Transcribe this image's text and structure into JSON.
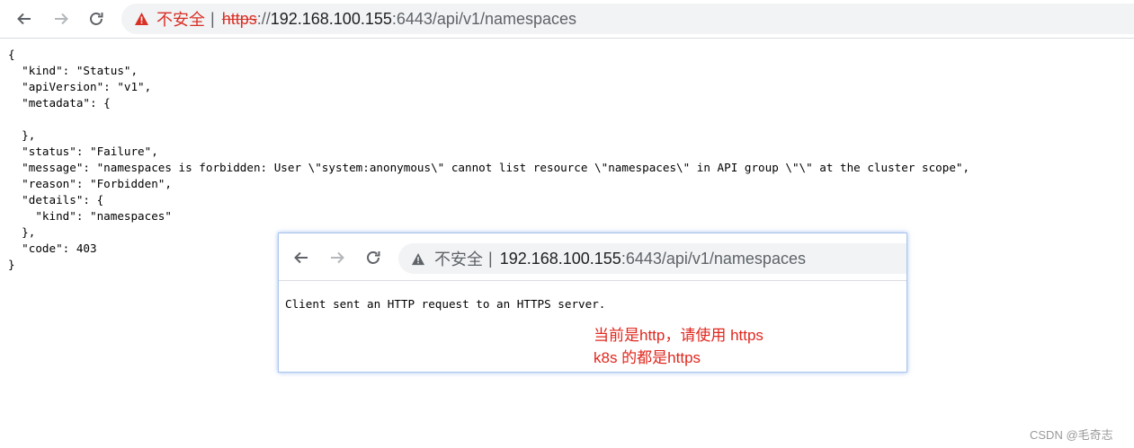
{
  "browser": {
    "insecure_label": "不安全",
    "separator": "|",
    "url_scheme": "https",
    "url_scheme_sep": "://",
    "url_host": "192.168.100.155",
    "url_path": ":6443/api/v1/namespaces"
  },
  "json_lines": [
    "{",
    "  \"kind\": \"Status\",",
    "  \"apiVersion\": \"v1\",",
    "  \"metadata\": {",
    "",
    "  },",
    "  \"status\": \"Failure\",",
    "  \"message\": \"namespaces is forbidden: User \\\"system:anonymous\\\" cannot list resource \\\"namespaces\\\" in API group \\\"\\\" at the cluster scope\",",
    "  \"reason\": \"Forbidden\",",
    "  \"details\": {",
    "    \"kind\": \"namespaces\"",
    "  },",
    "  \"code\": 403",
    "}"
  ],
  "popup": {
    "insecure_label": "不安全",
    "separator": "|",
    "url_host": "192.168.100.155",
    "url_path": ":6443/api/v1/namespaces",
    "message": "Client sent an HTTP request to an HTTPS server.",
    "note_line1": "当前是http，请使用 https",
    "note_line2": "k8s 的都是https"
  },
  "watermark": "CSDN @毛奇志",
  "colors": {
    "warning_red": "#d93025",
    "note_red": "#e0271e",
    "omnibox_bg": "#f1f3f4"
  },
  "icons": [
    "back-arrow-icon",
    "forward-arrow-icon",
    "reload-icon",
    "warning-triangle-icon"
  ]
}
